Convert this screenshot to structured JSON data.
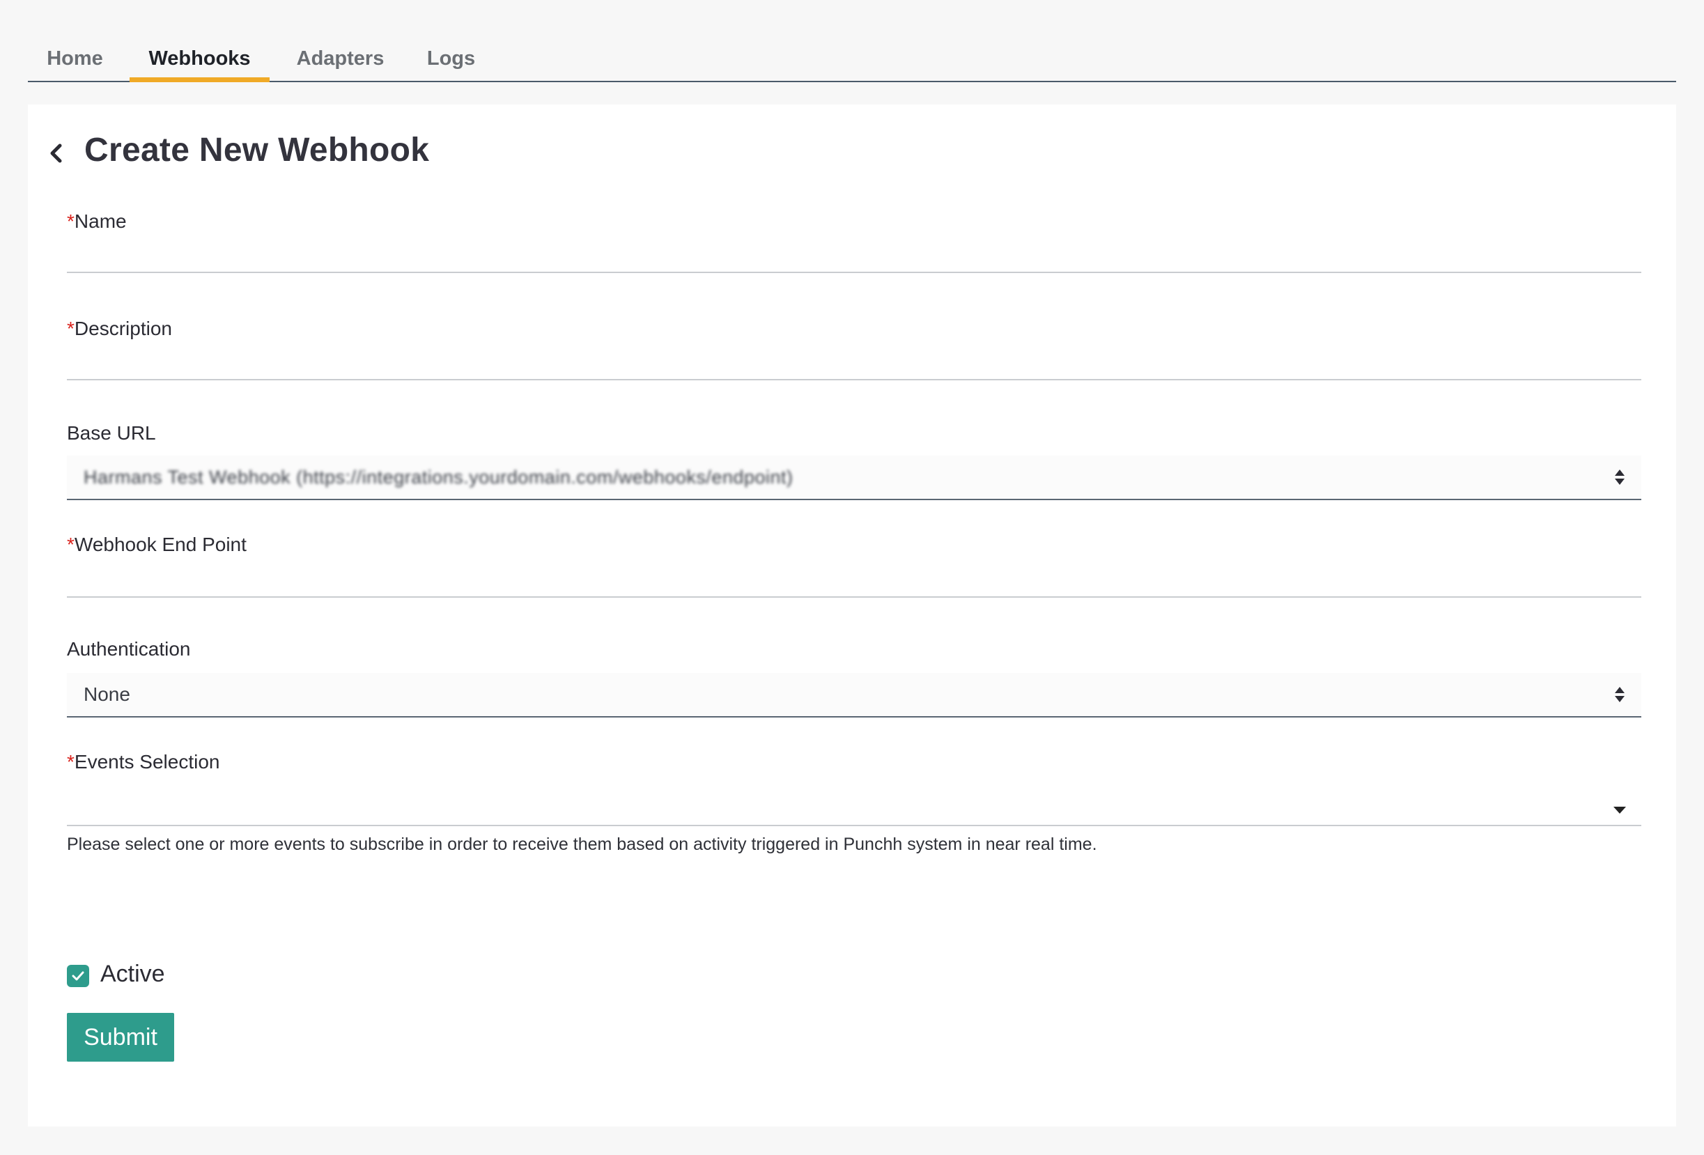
{
  "tabs": [
    {
      "label": "Home",
      "active": false
    },
    {
      "label": "Webhooks",
      "active": true
    },
    {
      "label": "Adapters",
      "active": false
    },
    {
      "label": "Logs",
      "active": false
    }
  ],
  "page": {
    "title": "Create New Webhook",
    "back_icon": "chevron-left-icon"
  },
  "form": {
    "required_marker": "*",
    "name": {
      "label": "Name",
      "value": ""
    },
    "description": {
      "label": "Description",
      "value": ""
    },
    "base_url": {
      "label": "Base URL",
      "value": "Harmans Test Webhook (https://integrations.yourdomain.com/webhooks/endpoint)"
    },
    "endpoint": {
      "label": "Webhook End Point",
      "value": ""
    },
    "authentication": {
      "label": "Authentication",
      "value": "None"
    },
    "events": {
      "label": "Events Selection",
      "value": "",
      "help": "Please select one or more events to subscribe in order to receive them based on activity triggered in Punchh system in near real time."
    },
    "active": {
      "label": "Active",
      "checked": true
    },
    "submit_label": "Submit"
  },
  "colors": {
    "accent": "#2e9c8c",
    "tab_indicator": "#f0aa27",
    "required": "#d9231d"
  }
}
